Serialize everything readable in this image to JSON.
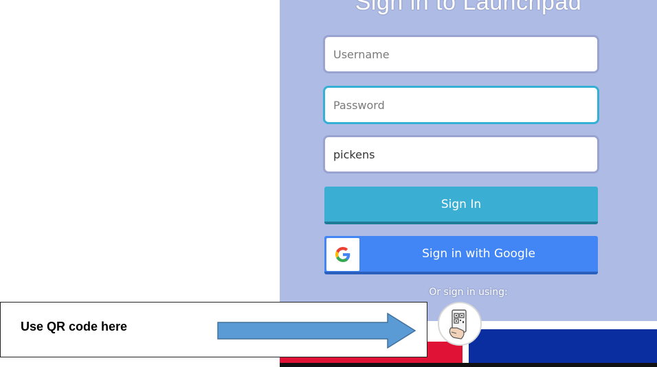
{
  "login": {
    "title": "Sign in to Launchpad",
    "username_placeholder": "Username",
    "password_placeholder": "Password",
    "district_value": "pickens",
    "signin_label": "Sign In",
    "google_label": "Sign in with Google",
    "or_text": "Or sign in using:",
    "qr_icon": "qr-code-badge-icon",
    "google_icon": "google-g-icon"
  },
  "callout": {
    "text": "Use QR code here",
    "arrow_icon": "right-arrow-icon"
  },
  "colors": {
    "panel_bg": "#adbbe5",
    "signin_button": "#3aaed3",
    "google_button": "#4285f4",
    "focus_border": "#36afd4",
    "strip_red": "#e01235",
    "strip_blue": "#0a2ea0",
    "arrow_fill": "#5b9bd5"
  }
}
